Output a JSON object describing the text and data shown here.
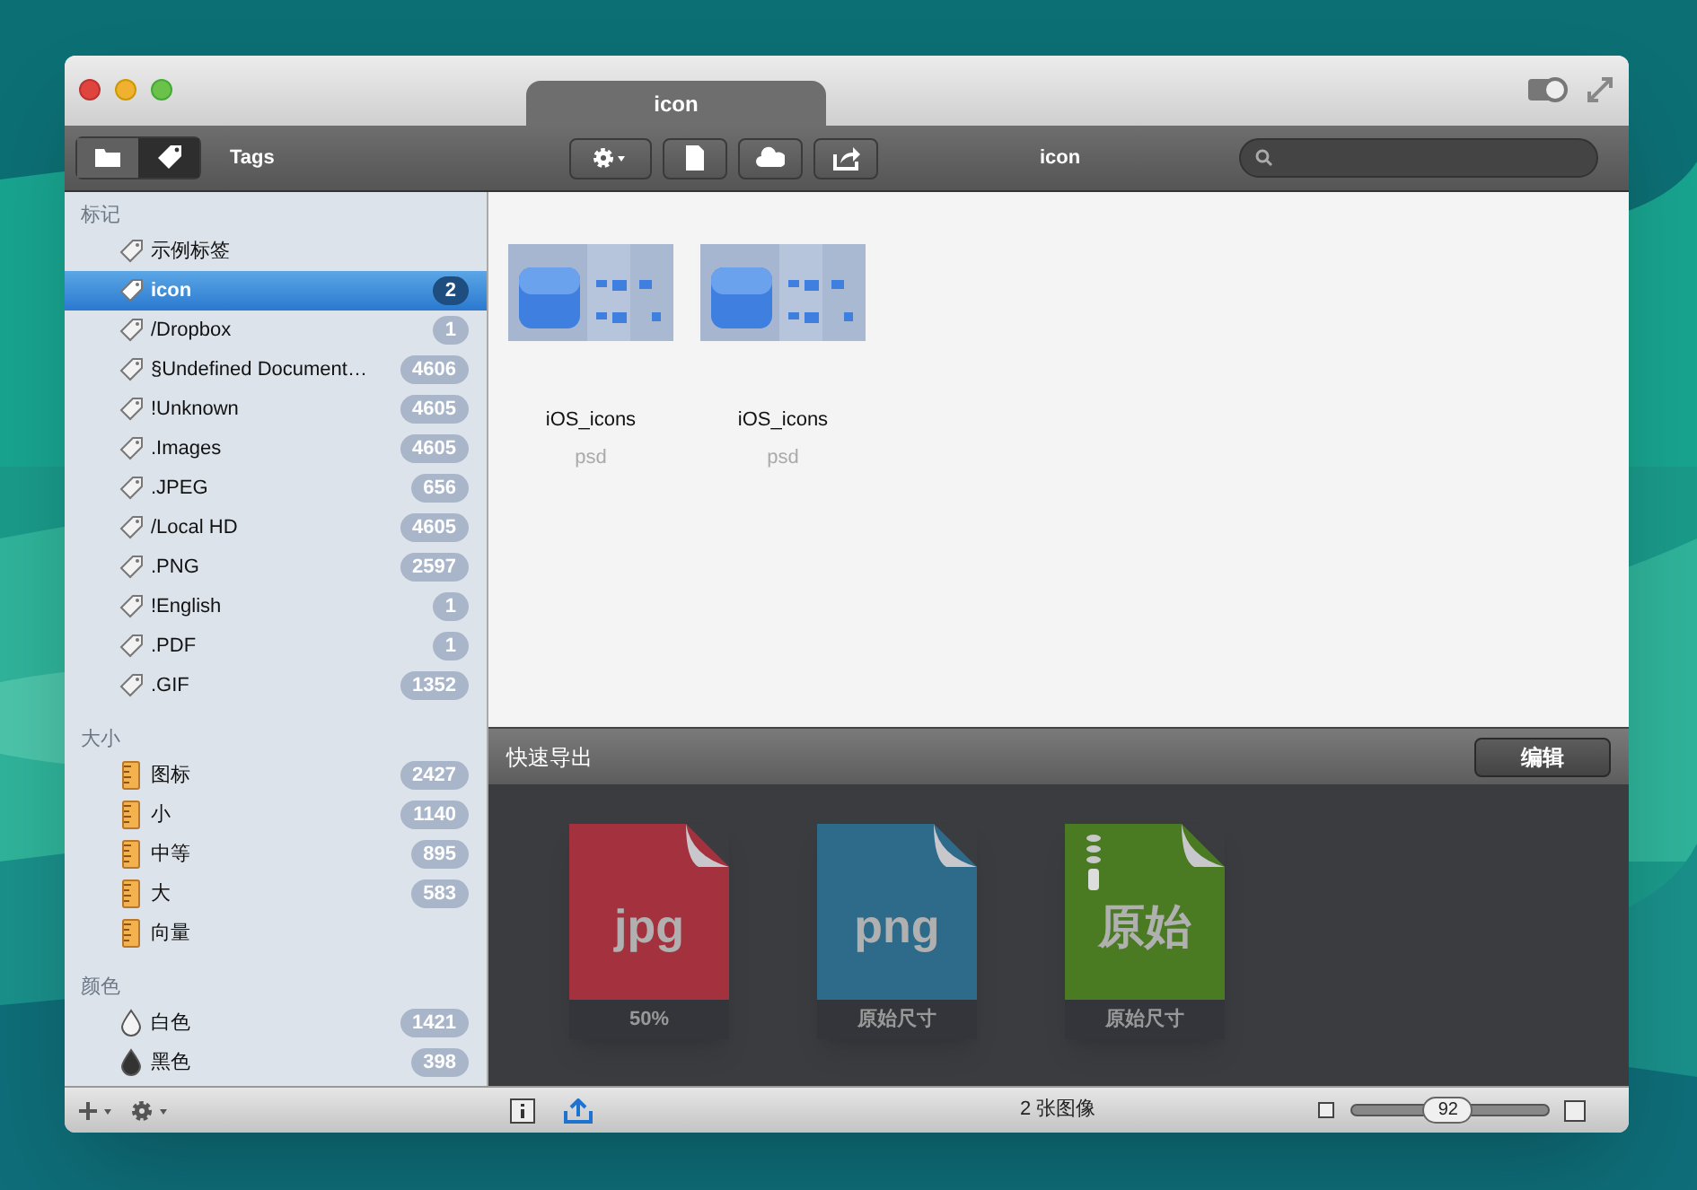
{
  "window": {
    "tab_title": "icon"
  },
  "toolbar": {
    "view_buttons": [
      {
        "kind": "folder",
        "selected": false
      },
      {
        "kind": "tag",
        "selected": true
      }
    ],
    "label": "Tags",
    "buttons": [
      {
        "kind": "gear"
      },
      {
        "kind": "document"
      },
      {
        "kind": "cloud"
      },
      {
        "kind": "share"
      }
    ],
    "title": "icon"
  },
  "sidebar": {
    "sections": [
      {
        "title": "标记",
        "kind": "tag",
        "items": [
          {
            "label": "示例标签",
            "selected": false
          },
          {
            "label": "icon",
            "count": "2",
            "selected": true
          },
          {
            "label": "/Dropbox",
            "count": "1",
            "selected": false
          },
          {
            "label": "§Undefined Document…",
            "count": "4606",
            "selected": false
          },
          {
            "label": "!Unknown",
            "count": "4605",
            "selected": false
          },
          {
            "label": ".Images",
            "count": "4605",
            "selected": false
          },
          {
            "label": ".JPEG",
            "count": "656",
            "selected": false
          },
          {
            "label": "/Local HD",
            "count": "4605",
            "selected": false
          },
          {
            "label": ".PNG",
            "count": "2597",
            "selected": false
          },
          {
            "label": "!English",
            "count": "1",
            "selected": false
          },
          {
            "label": ".PDF",
            "count": "1",
            "selected": false
          },
          {
            "label": ".GIF",
            "count": "1352",
            "selected": false
          }
        ]
      },
      {
        "title": "大小",
        "kind": "ruler",
        "items": [
          {
            "label": "图标",
            "count": "2427",
            "selected": false
          },
          {
            "label": "小",
            "count": "1140",
            "selected": false
          },
          {
            "label": "中等",
            "count": "895",
            "selected": false
          },
          {
            "label": "大",
            "count": "583",
            "selected": false
          },
          {
            "label": "向量",
            "selected": false
          }
        ]
      },
      {
        "title": "颜色",
        "kind": "drop",
        "items": [
          {
            "label": "白色",
            "count": "1421",
            "selected": false,
            "color": "#f4f4f4"
          },
          {
            "label": "黑色",
            "count": "398",
            "selected": false,
            "color": "#333333"
          }
        ]
      }
    ]
  },
  "files": [
    {
      "name": "iOS_icons",
      "ext": "psd",
      "kind": "picture"
    },
    {
      "name": "iOS_icons",
      "ext": "psd",
      "kind": "picture"
    }
  ],
  "quick_export": {
    "title": "快速导出",
    "edit_button": "编辑",
    "presets": [
      {
        "label": "jpg",
        "caption": "50%",
        "color": "#a3323e",
        "zipped": false
      },
      {
        "label": "png",
        "caption": "原始尺寸",
        "color": "#2e6a8a",
        "zipped": false
      },
      {
        "label": "原始",
        "caption": "原始尺寸",
        "color": "#4a7a22",
        "zipped": true
      }
    ]
  },
  "status_bar": {
    "count": "2 张图像",
    "zoom": {
      "level": 0.49,
      "reading": "92"
    }
  }
}
